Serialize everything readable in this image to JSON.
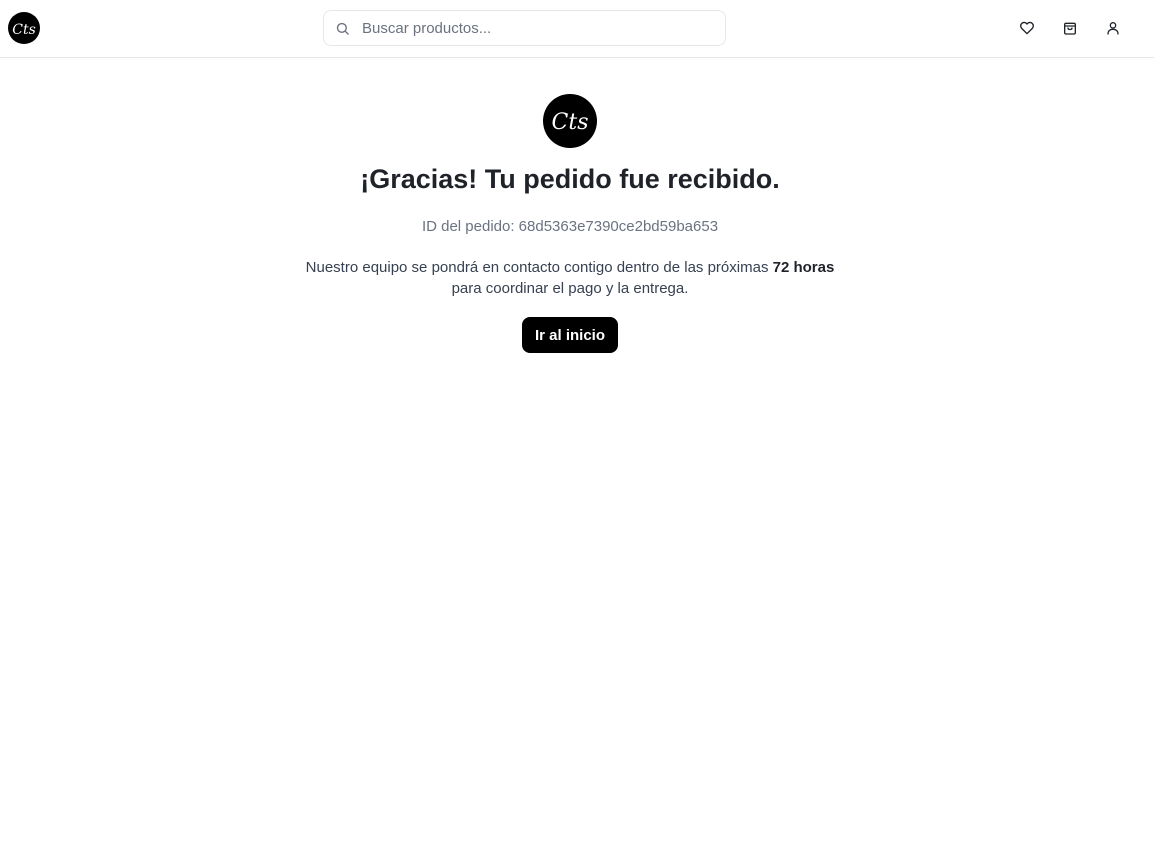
{
  "header": {
    "logo_text": "Cts",
    "search": {
      "placeholder": "Buscar productos...",
      "value": ""
    },
    "icons": [
      "heart-icon",
      "shopping-bag-icon",
      "user-icon"
    ]
  },
  "confirmation": {
    "logo_text": "Cts",
    "title": "¡Gracias! Tu pedido fue recibido.",
    "order_id": "ID del pedido: 68d5363e7390ce2bd59ba653",
    "message_before": "Nuestro equipo se pondrá en contacto contigo dentro de las próximas",
    "message_bold": "72 horas",
    "message_after": "para coordinar el pago y la entrega.",
    "button_label": "Ir al inicio"
  },
  "colors": {
    "accent": "#000000",
    "text": "#1f2329",
    "muted": "#6b7280",
    "border": "#e5e7eb"
  }
}
